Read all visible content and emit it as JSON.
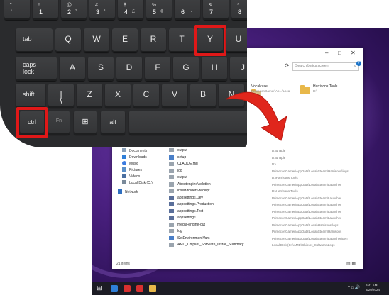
{
  "keyboard": {
    "number_row": [
      {
        "top": "\"",
        "bottom": "'",
        "side": ""
      },
      {
        "top": "!",
        "bottom": "1",
        "side": ""
      },
      {
        "top": "@",
        "bottom": "2",
        "side": "²"
      },
      {
        "top": "#",
        "bottom": "3",
        "side": "³"
      },
      {
        "top": "$",
        "bottom": "4",
        "side": "£"
      },
      {
        "top": "%",
        "bottom": "5",
        "side": "¢"
      },
      {
        "top": "",
        "bottom": "6",
        "side": "¬"
      },
      {
        "top": "&",
        "bottom": "7",
        "side": ""
      },
      {
        "top": "*",
        "bottom": "8",
        "side": ""
      }
    ],
    "row_qwerty": [
      "tab",
      "Q",
      "W",
      "E",
      "R",
      "T",
      "Y",
      "U"
    ],
    "row_home": [
      "caps\nlock",
      "A",
      "S",
      "D",
      "F",
      "G",
      "H",
      "J"
    ],
    "row_shift": [
      "shift",
      "|\n\\",
      "Z",
      "X",
      "C",
      "V",
      "B",
      "N"
    ],
    "row_bottom": [
      "ctrl",
      "Fn",
      "win",
      "alt"
    ],
    "highlighted": [
      "Y",
      "ctrl"
    ],
    "highlight_color": "#e01818"
  },
  "explorer": {
    "window_controls": {
      "minimize": "–",
      "maximize": "□",
      "close": "✕"
    },
    "search_placeholder": "Search Lyrics screen",
    "quick_access": [
      {
        "title": "Vocalcase",
        "subtitle": "PrimeconGamer\\Ap...\\Local"
      },
      {
        "title": "Harrisons Tools",
        "subtitle": "D:\\"
      }
    ],
    "nav_items": [
      {
        "label": "Documents",
        "icon": "documents-icon"
      },
      {
        "label": "Downloads",
        "icon": "downloads-icon"
      },
      {
        "label": "Music",
        "icon": "music-icon"
      },
      {
        "label": "Pictures",
        "icon": "pictures-icon"
      },
      {
        "label": "Videos",
        "icon": "videos-icon"
      },
      {
        "label": "Local Disk (C:)",
        "icon": "drive-icon"
      },
      {
        "label": "Network",
        "icon": "network-icon"
      }
    ],
    "files": [
      {
        "name": "output",
        "path": "D:\\unaple",
        "icon": "file-icon"
      },
      {
        "name": "setup",
        "path": "D:\\unaple",
        "icon": "setup-icon"
      },
      {
        "name": "CLAUDE.md",
        "path": "D:\\",
        "icon": "file-icon"
      },
      {
        "name": "log",
        "path": "PrimeconGamer\\AppData\\Local\\Steam\\Harrisons\\logs",
        "icon": "file-icon"
      },
      {
        "name": "output",
        "path": "D:\\Harrisons Tools",
        "icon": "file-icon"
      },
      {
        "name": "Aboutengine\\solution",
        "path": "PrimeconGamer\\AppData\\Local\\Steam\\Launcher",
        "icon": "file-icon"
      },
      {
        "name": "insert-folders-receipt",
        "path": "D:\\Harrisons Tools",
        "icon": "file-icon"
      },
      {
        "name": "appsettings.Dev",
        "path": "PrimeconGamer\\AppData\\Local\\Steam\\Launcher",
        "icon": "settings-icon"
      },
      {
        "name": "appsettings.Production",
        "path": "PrimeconGamer\\AppData\\Local\\Steam\\Launcher",
        "icon": "settings-icon"
      },
      {
        "name": "appsettings.Test",
        "path": "PrimeconGamer\\AppData\\Local\\Steam\\Launcher",
        "icon": "settings-icon"
      },
      {
        "name": "appsettings",
        "path": "PrimeconGamer\\AppData\\Local\\Steam\\Launcher",
        "icon": "settings-icon"
      },
      {
        "name": "media-engine-out",
        "path": "PrimeconGamer\\AppData\\Local\\Harrisons\\logs",
        "icon": "file-icon"
      },
      {
        "name": "log",
        "path": "PrimeconGamer\\AppData\\Local\\Steam\\Harrisons",
        "icon": "file-icon"
      },
      {
        "name": "SetEnvironmentVars",
        "path": "PrimeconGamer\\AppData\\Local\\Steam\\Launcher\\gen",
        "icon": "setup-icon"
      },
      {
        "name": "AMD_Chipset_Software_Install_Summary",
        "path": "Local Disk (C:)\\AMD\\Chipset_Software\\Logs",
        "icon": "file-icon"
      }
    ],
    "status": "21 items",
    "view_icons": "▤ ▦"
  },
  "taskbar": {
    "tray": "^ ⌂ 🔊",
    "clock_time": "9:41 AM",
    "clock_date": "3/20/2024"
  },
  "colors": {
    "arrow": "#e0261c",
    "folder": "#e8b84a"
  }
}
